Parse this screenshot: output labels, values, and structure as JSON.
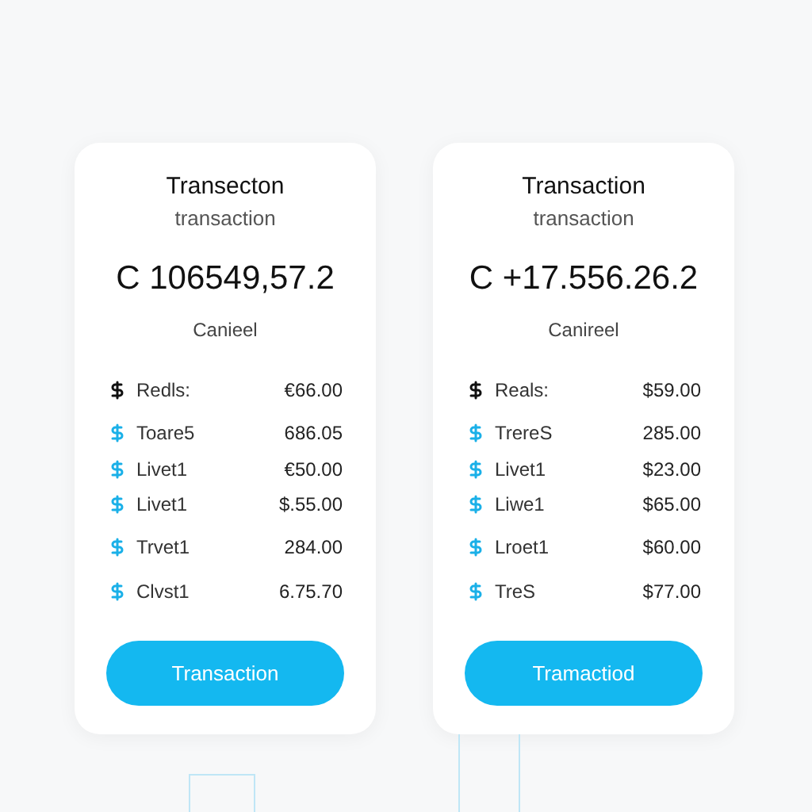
{
  "cards": [
    {
      "title": "Transecton",
      "subtitle": "transaction",
      "amount": "C 106549,57.2",
      "status": "Canieel",
      "rows": [
        {
          "kind": "header",
          "label": "Redls:",
          "value": "€66.00"
        },
        {
          "kind": "item",
          "label": "Toare5",
          "value": "686.05"
        },
        {
          "kind": "item",
          "label": "Livet1",
          "value": "€50.00"
        },
        {
          "kind": "item",
          "label": "Livet1",
          "value": "$.55.00"
        },
        {
          "kind": "item",
          "label": "Trvet1",
          "value": "284.00"
        },
        {
          "kind": "item",
          "label": "Clvst1",
          "value": "6.75.70"
        }
      ],
      "button": "Transaction"
    },
    {
      "title": "Transaction",
      "subtitle": "transaction",
      "amount": "C +17.556.26.2",
      "status": "Canireel",
      "rows": [
        {
          "kind": "header",
          "label": "Reals:",
          "value": "$59.00"
        },
        {
          "kind": "item",
          "label": "TrereS",
          "value": "285.00"
        },
        {
          "kind": "item",
          "label": "Livet1",
          "value": "$23.00"
        },
        {
          "kind": "item",
          "label": "Liwe1",
          "value": "$65.00"
        },
        {
          "kind": "item",
          "label": "Lroet1",
          "value": "$60.00"
        },
        {
          "kind": "item",
          "label": "TreS",
          "value": "$77.00"
        }
      ],
      "button": "Tramactiod"
    }
  ]
}
